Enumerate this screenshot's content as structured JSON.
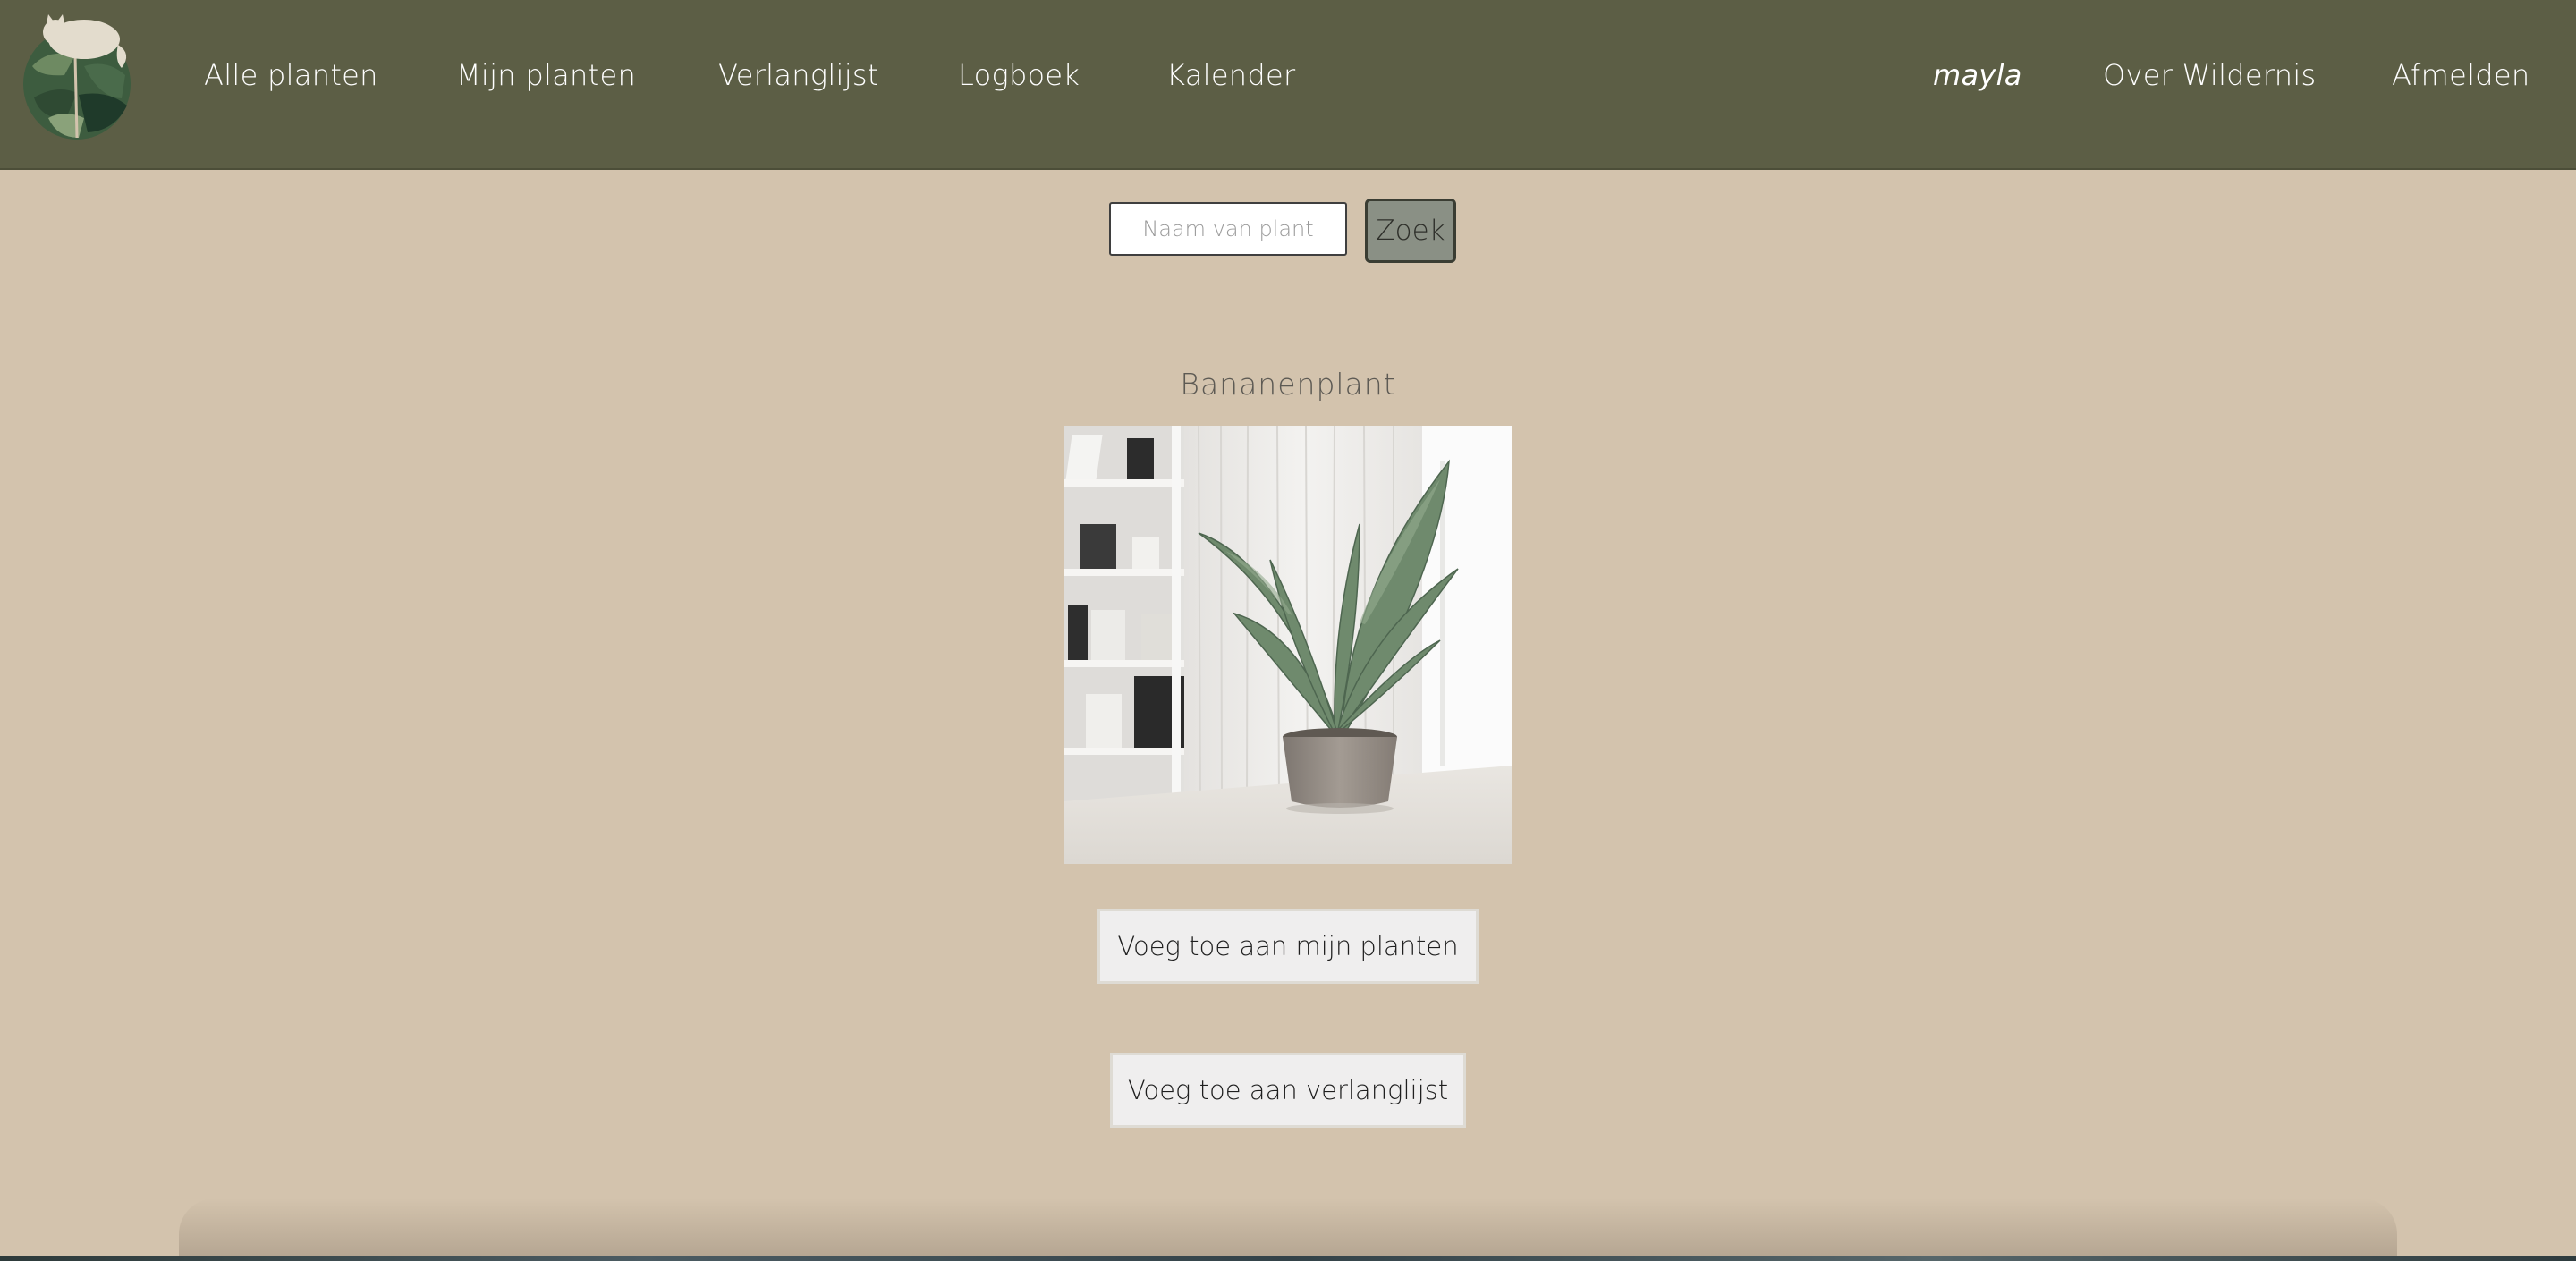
{
  "nav": {
    "logo_icon": "monstera-leaf-cat-logo-icon",
    "links": {
      "alle_planten": "Alle planten",
      "mijn_planten": "Mijn planten",
      "verlanglijst": "Verlanglijst",
      "logboek": "Logboek",
      "kalender": "Kalender"
    },
    "user": "mayla",
    "over": "Over Wildernis",
    "afmelden": "Afmelden"
  },
  "search": {
    "placeholder": "Naam van plant",
    "value": "",
    "button_label": "Zoek"
  },
  "plant": {
    "name": "Bananenplant",
    "image_alt": "potted-banana-plant-photo"
  },
  "actions": {
    "add_mijn_planten": "Voeg toe aan mijn planten",
    "add_verlanglijst": "Voeg toe aan verlanglijst"
  },
  "colors": {
    "navbar": "#5c5e45",
    "background": "#d3c3ad",
    "search_button": "#8a9085",
    "action_button": "#efeeee"
  }
}
